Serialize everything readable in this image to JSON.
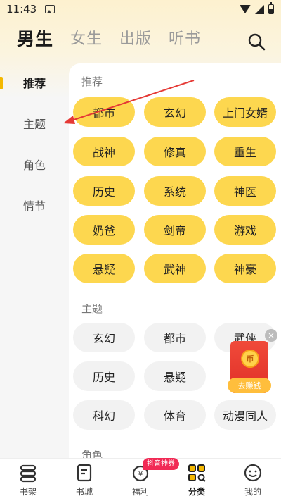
{
  "status_bar": {
    "time": "11:43"
  },
  "top_tabs": [
    {
      "label": "男生",
      "active": true
    },
    {
      "label": "女生",
      "active": false
    },
    {
      "label": "出版",
      "active": false
    },
    {
      "label": "听书",
      "active": false
    }
  ],
  "sidebar": {
    "items": [
      {
        "label": "推荐",
        "active": true
      },
      {
        "label": "主题",
        "active": false
      },
      {
        "label": "角色",
        "active": false
      },
      {
        "label": "情节",
        "active": false
      }
    ]
  },
  "sections": {
    "recommend": {
      "title": "推荐",
      "tags": [
        "都市",
        "玄幻",
        "上门女婿",
        "战神",
        "修真",
        "重生",
        "历史",
        "系统",
        "神医",
        "奶爸",
        "剑帝",
        "游戏",
        "悬疑",
        "武神",
        "神豪"
      ]
    },
    "theme": {
      "title": "主题",
      "tags": [
        "玄幻",
        "都市",
        "武侠",
        "历史",
        "悬疑",
        "科幻",
        "体育",
        "动漫同人"
      ]
    },
    "role": {
      "title": "角色"
    }
  },
  "float_widget": {
    "coin_text": "币",
    "button_label": "去赚钱",
    "close": "×"
  },
  "bottom_nav": {
    "badge": "抖音神券",
    "items": [
      {
        "label": "书架",
        "icon": "bookshelf-icon"
      },
      {
        "label": "书城",
        "icon": "bookstore-icon"
      },
      {
        "label": "福利",
        "icon": "welfare-icon"
      },
      {
        "label": "分类",
        "icon": "category-icon",
        "active": true
      },
      {
        "label": "我的",
        "icon": "profile-icon"
      }
    ]
  },
  "colors": {
    "accent": "#fdd74f",
    "indicator": "#f4b800",
    "annotation_arrow": "#e53935"
  }
}
